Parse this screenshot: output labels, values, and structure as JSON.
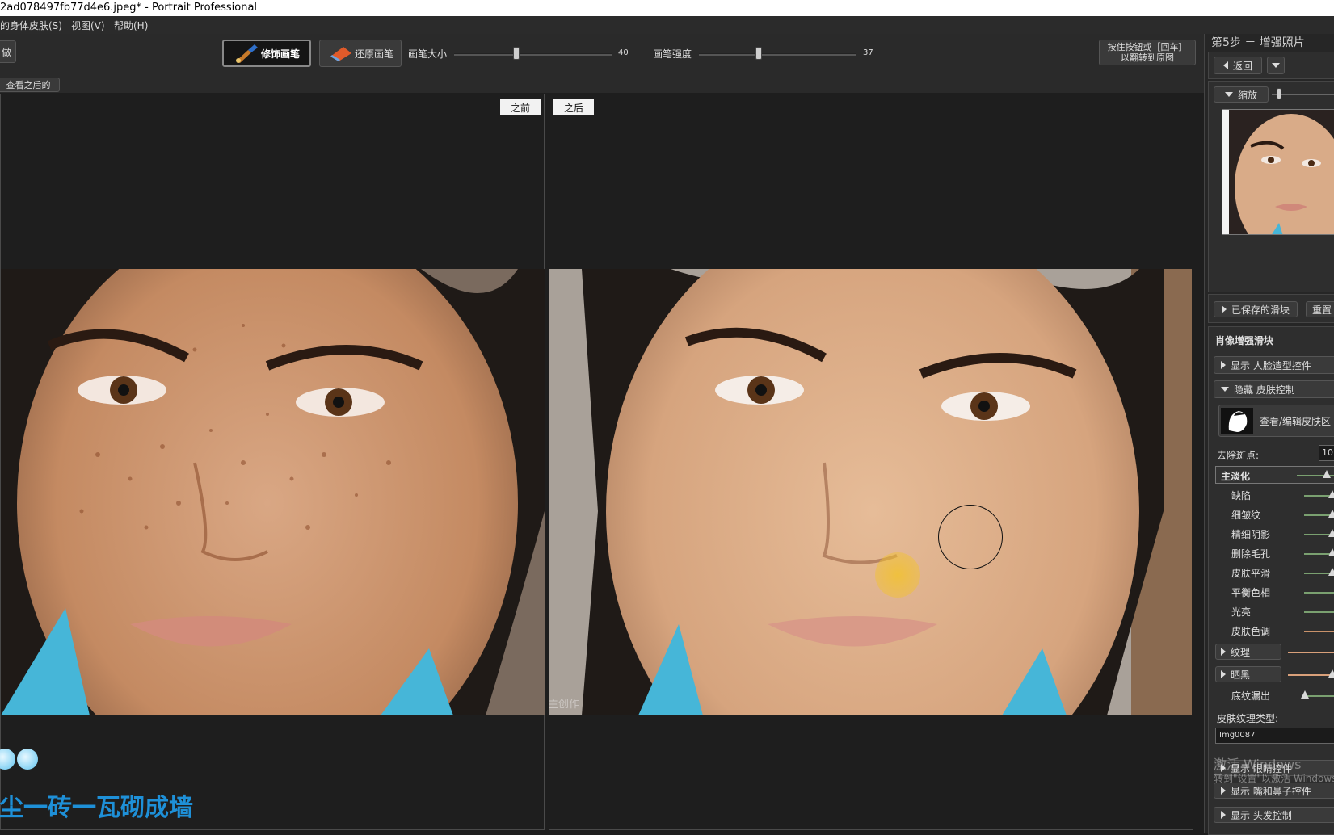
{
  "window": {
    "title": "2ad078497fb77d4e6.jpeg* - Portrait Professional"
  },
  "menu": {
    "items": [
      "的身体皮肤(S)",
      "视图(V)",
      "帮助(H)"
    ]
  },
  "toolbar": {
    "left_button": "做",
    "retouch_brush": "修饰画笔",
    "restore_brush": "还原画笔",
    "brush_size_label": "画笔大小",
    "brush_size_value": "40",
    "brush_strength_label": "画笔强度",
    "brush_strength_value": "37",
    "flip_button_line1": "按住按钮或［回车］",
    "flip_button_line2": "以翻转到原图",
    "view_after": "查看之后的"
  },
  "panes": {
    "before_label": "之前",
    "after_label": "之后"
  },
  "watermark": {
    "caption": "尘一砖一瓦砌成墙",
    "bottom_text": "主创作"
  },
  "sidebar": {
    "step_title": "第5步 － 增强照片",
    "back_button": "返回",
    "zoom_label": "缩放",
    "saved_sliders": "已保存的滑块",
    "reset_button": "重置",
    "section_title": "肖像增强滑块",
    "show_face_shape": "显示 人脸造型控件",
    "hide_skin": "隐藏 皮肤控制",
    "view_edit_skin": "查看/编辑皮肤区",
    "remove_spots_label": "去除斑点:",
    "remove_spots_value": "10",
    "main_smooth": "主淡化",
    "sliders": [
      "缺陷",
      "细皱纹",
      "精细阴影",
      "删除毛孔",
      "皮肤平滑",
      "平衡色相",
      "光亮",
      "皮肤色调"
    ],
    "texture_button": "纹理",
    "tan_button": "晒黑",
    "texture_leak": "底纹漏出",
    "skin_texture_type_label": "皮肤纹理类型:",
    "skin_texture_type_value": "Img0087",
    "activate_windows_1": "激活 Windows",
    "activate_windows_2": "转到\"设置\"以激活 Windows",
    "show_eyes": "显示 眼睛控件",
    "show_mouth_nose": "显示 嘴和鼻子控件",
    "show_hair": "显示 头发控制"
  },
  "colors": {
    "accent_blue": "#1e90d8",
    "cursor_dot": "#f2c230"
  }
}
